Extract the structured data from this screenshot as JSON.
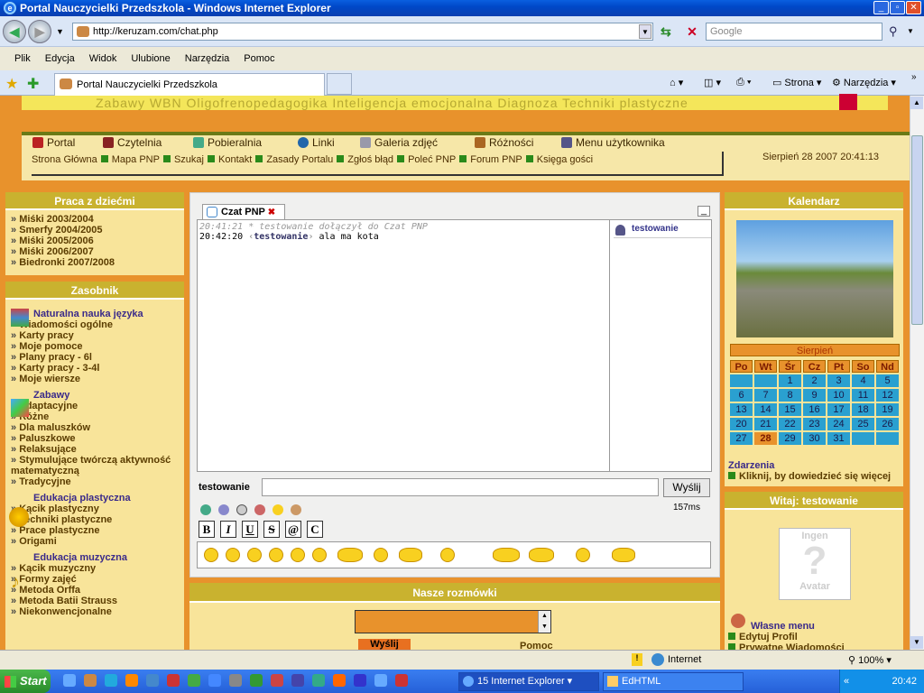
{
  "window": {
    "title": "Portal Nauczycielki Przedszkola - Windows Internet Explorer"
  },
  "address": {
    "url": "http://keruzam.com/chat.php",
    "search_placeholder": "Google"
  },
  "menu": [
    "Plik",
    "Edycja",
    "Widok",
    "Ulubione",
    "Narzędzia",
    "Pomoc"
  ],
  "tab": {
    "label": "Portal Nauczycielki Przedszkola"
  },
  "toolbar": {
    "strona": "Strona",
    "narzedzia": "Narzędzia"
  },
  "banner": "Zabawy   WBN   Oligofrenopedagogika   Inteligencja emocjonalna   Diagnoza   Techniki plastyczne",
  "nav": {
    "main": [
      "Portal",
      "Czytelnia",
      "Pobieralnia",
      "Linki",
      "Galeria zdjęć",
      "Różności",
      "Menu użytkownika"
    ],
    "sub": [
      "Strona Główna",
      "Mapa PNP",
      "Szukaj",
      "Kontakt",
      "Zasady Portalu",
      "Zgłoś błąd",
      "Poleć PNP",
      "Forum PNP",
      "Księga gości"
    ],
    "datetime": "Sierpień 28 2007 20:41:13"
  },
  "left": {
    "praca_title": "Praca z dziećmi",
    "praca_items": [
      "Miśki 2003/2004",
      "Smerfy 2004/2005",
      "Miśki 2005/2006",
      "Miśki 2006/2007",
      "Biedronki 2007/2008"
    ],
    "zasobnik_title": "Zasobnik",
    "sec1": "Naturalna nauka języka",
    "sec1_items": [
      "Wiadomości ogólne",
      "Karty pracy",
      "Moje pomoce",
      "Plany pracy - 6l",
      "Karty pracy - 3-4l",
      "Moje wiersze"
    ],
    "sec2": "Zabawy",
    "sec2_items": [
      "Adaptacyjne",
      "Różne",
      "Dla maluszków",
      "Paluszkowe",
      "Relaksujące",
      "Stymulujące twórczą aktywność matematyczną",
      "Tradycyjne"
    ],
    "sec3": "Edukacja plastyczna",
    "sec3_items": [
      "Kącik plastyczny",
      "Techniki plastyczne",
      "Prace plastyczne",
      "Origami"
    ],
    "sec4": "Edukacja muzyczna",
    "sec4_items": [
      "Kącik muzyczny",
      "Formy zajęć",
      "Metoda Orffa",
      "Metoda Batii Strauss",
      "Niekonwencjonalne"
    ]
  },
  "chat": {
    "tab": "Czat PNP",
    "line1_time": "20:41:21",
    "line1_text": "* testowanie dołączył do Czat PNP",
    "line2_time": "20:42:20",
    "line2_user": "testowanie",
    "line2_text": "ala ma kota",
    "user": "testowanie",
    "nick": "testowanie",
    "send": "Wyślij",
    "ping": "157ms",
    "format_buttons": [
      "B",
      "I",
      "U",
      "S",
      "@",
      "C"
    ]
  },
  "rozmowki": {
    "title": "Nasze rozmówki",
    "send": "Wyślij",
    "help": "Pomoc"
  },
  "right": {
    "cal_title": "Kalendarz",
    "month": "Sierpień",
    "weekdays": [
      "Po",
      "Wt",
      "Śr",
      "Cz",
      "Pt",
      "So",
      "Nd"
    ],
    "days": [
      "",
      "",
      "1",
      "2",
      "3",
      "4",
      "5",
      "6",
      "7",
      "8",
      "9",
      "10",
      "11",
      "12",
      "13",
      "14",
      "15",
      "16",
      "17",
      "18",
      "19",
      "20",
      "21",
      "22",
      "23",
      "24",
      "25",
      "26",
      "27",
      "28",
      "29",
      "30",
      "31",
      "",
      ""
    ],
    "today": "28",
    "events_title": "Zdarzenia",
    "events_link": "Kliknij, by dowiedzieć się więcej",
    "welcome": "Witaj: testowanie",
    "avatar_top": "Ingen",
    "avatar_bottom": "Avatar",
    "own_menu": "Własne menu",
    "edit_profile": "Edytuj Profil",
    "private": "Prywatne Wiadomości"
  },
  "status": {
    "zone": "Internet",
    "zoom": "100%"
  },
  "taskbar": {
    "start": "Start",
    "task1": "15 Internet Explorer",
    "task2": "EdHTML",
    "time": "20:42"
  }
}
